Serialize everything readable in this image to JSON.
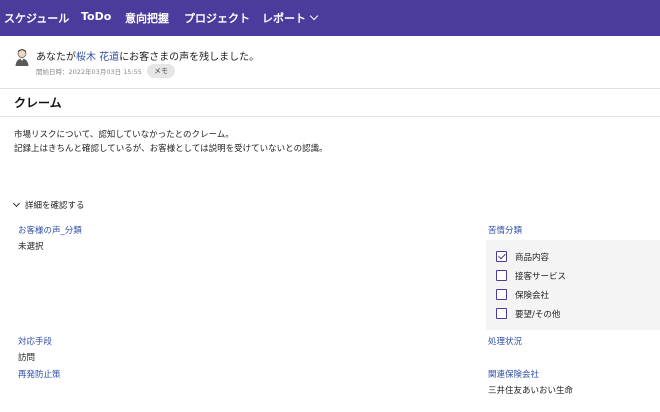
{
  "nav": {
    "items": [
      {
        "label": "スケジュール"
      },
      {
        "label": "ToDo"
      },
      {
        "label": "意向把握"
      },
      {
        "label": "プロジェクト"
      },
      {
        "label": "レポート"
      }
    ]
  },
  "activity": {
    "prefix": "あなたが",
    "user": "桜木 花道",
    "suffix": "にお客さまの声を残しました。",
    "meta": "開始日時：2022年03月03日 15:55",
    "badge": "メモ"
  },
  "title": "クレーム",
  "body": {
    "line1": "市場リスクについて、認知していなかったとのクレーム。",
    "line2": "記録上はきちんと確認しているが、お客様としては説明を受けていないとの認識。"
  },
  "details_toggle": "詳細を確認する",
  "fields": {
    "voice_category": {
      "label": "お客様の声_分類",
      "value": "未選択"
    },
    "complaint_category": {
      "label": "苦情分類",
      "options": [
        {
          "label": "商品内容",
          "checked": true
        },
        {
          "label": "接客サービス",
          "checked": false
        },
        {
          "label": "保険会社",
          "checked": false
        },
        {
          "label": "要望/その他",
          "checked": false
        }
      ]
    },
    "response_method": {
      "label": "対応手段",
      "value": "訪問"
    },
    "processing_status": {
      "label": "処理状況",
      "value": ""
    },
    "prevention": {
      "label": "再発防止策",
      "value": ""
    },
    "insurer": {
      "label": "関連保険会社",
      "value": "三井住友あいおい生命"
    }
  },
  "colors": {
    "nav_bg": "#4b3b9c",
    "link": "#2f4fa8",
    "panel_bg": "#f4f4f4"
  }
}
